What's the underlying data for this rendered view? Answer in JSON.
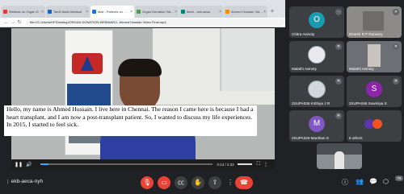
{
  "browser": {
    "tabs": [
      {
        "title": "Webinar on Organ D",
        "color": "#e53935"
      },
      {
        "title": "Tamil Nadu Medical",
        "color": "#1565c0"
      },
      {
        "title": "Mail - Patients on Organ Donation",
        "color": "#1976d2"
      },
      {
        "title": "Organ Donation Videos",
        "color": "#43a047"
      },
      {
        "title": "Meet - ekb-aeca",
        "color": "#00897b"
      },
      {
        "title": "Ahmed Hussain Video",
        "color": "#fb8c00"
      }
    ],
    "active_tab": 2,
    "url": "file:///C:/Users/HP/Desktop/ORGAN DONATION WEBINAR/1. Ahmed Hussain Video Final.mp4"
  },
  "video": {
    "captions": "Hello, my name is Ahmed Hussain. I live here in Chennai. The reason I came here is because I had a heart transplant, and I am now a post-transplant patient. So, I wanted to discuss my life experiences. In 2015, I started to feel sick.",
    "poster_text": "INDIAN TRANSPLANT",
    "timecode": "0:13 / 4:32",
    "progress": 0.05
  },
  "participants": [
    {
      "name": "Chitra Avinoty",
      "type": "letter",
      "letter": "O",
      "color": "#1a9cb0",
      "mic": "⋯"
    },
    {
      "name": "Dinesh R P Ramany",
      "type": "video",
      "color": "#8d8b88",
      "mic": "🎤"
    },
    {
      "name": "Malathi Avinoty",
      "type": "image",
      "color": "#e8eaed",
      "mic": "🎤"
    },
    {
      "name": "Malathi Avinoty",
      "type": "video",
      "color": "#7b7f85",
      "mic": "🎤"
    },
    {
      "name": "2SUPA036 Krithiya J R",
      "type": "image",
      "color": "#cfd8dc",
      "mic": "🎤"
    },
    {
      "name": "2SUPA046 Sowmiya S",
      "type": "letter",
      "letter": "S",
      "color": "#8e24aa",
      "mic": "🎤"
    },
    {
      "name": "2SUPA029 Manthan S",
      "type": "letter",
      "letter": "M",
      "color": "#7e57c2",
      "mic": "🎤"
    },
    {
      "name": "6 others",
      "type": "others",
      "color": "#5e35b1",
      "mic": ""
    }
  ],
  "self_view": {
    "label": "You"
  },
  "toolbar": {
    "meeting_code": "ekb-aeca-nyh",
    "time": "",
    "participant_count": "76",
    "icons": [
      "mic-off-icon",
      "camera-off-icon",
      "captions-icon",
      "raise-hand-icon",
      "present-icon",
      "more-icon"
    ]
  }
}
